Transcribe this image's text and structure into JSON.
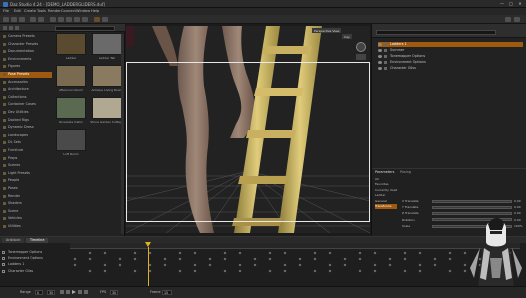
{
  "window": {
    "title": "Daz Studio 4.24 - [DEMO_LADDERGLIDERS.duf]",
    "controls": [
      "—",
      "□",
      "✕"
    ]
  },
  "menu": [
    "File",
    "Edit",
    "Create",
    "Tools",
    "Render",
    "Connect",
    "Window",
    "Help"
  ],
  "content_tree": {
    "items": [
      {
        "label": "Camera Presets",
        "selected": false
      },
      {
        "label": "Character Presets",
        "selected": false
      },
      {
        "label": "Documentation",
        "selected": false
      },
      {
        "label": "Environments",
        "selected": false
      },
      {
        "label": "Figures",
        "selected": false
      },
      {
        "label": "Pose Presets",
        "selected": true
      },
      {
        "label": "Accessories",
        "selected": false
      },
      {
        "label": "Architecture",
        "selected": false
      },
      {
        "label": "Collections",
        "selected": false
      },
      {
        "label": "Container Cases",
        "selected": false
      },
      {
        "label": "Dev Utilities",
        "selected": false
      },
      {
        "label": "Docked Rigs",
        "selected": false
      },
      {
        "label": "Dynamic Dress",
        "selected": false
      },
      {
        "label": "Landscapes",
        "selected": false
      },
      {
        "label": "DL Sets",
        "selected": false
      },
      {
        "label": "Furniture",
        "selected": false
      },
      {
        "label": "Props",
        "selected": false
      },
      {
        "label": "Scenes",
        "selected": false
      },
      {
        "label": "Light Presets",
        "selected": false
      },
      {
        "label": "People",
        "selected": false
      },
      {
        "label": "Poses",
        "selected": false
      },
      {
        "label": "Render",
        "selected": false
      },
      {
        "label": "Shaders",
        "selected": false
      },
      {
        "label": "Scene",
        "selected": false
      },
      {
        "label": "Vehicles",
        "selected": false
      },
      {
        "label": "Utilities",
        "selected": false
      }
    ]
  },
  "thumbnails": [
    {
      "label": "Ladder",
      "color": "#5a4a30"
    },
    {
      "label": "Ladder Tall",
      "color": "#6a6a6a"
    },
    {
      "label": "Afternoon Room",
      "color": "#7a6a50"
    },
    {
      "label": "Antique Living Room",
      "color": "#8a7a60"
    },
    {
      "label": "Riverside Cabin",
      "color": "#5a6a50"
    },
    {
      "label": "Stone Garden Cottage",
      "color": "#b0a890"
    },
    {
      "label": "Loft Room",
      "color": "#4a4a4a"
    }
  ],
  "viewport": {
    "camera_label": "Perspective View",
    "style_label": "Iray",
    "grid": true
  },
  "scene": {
    "items": [
      {
        "label": "Ladders 1",
        "selected": true
      },
      {
        "label": "Summer",
        "selected": false
      },
      {
        "label": "Tonemapper Options",
        "selected": false
      },
      {
        "label": "Environment Options",
        "selected": false
      },
      {
        "label": "Character Gliss",
        "selected": false
      }
    ]
  },
  "parameters": {
    "tabs": [
      "Parameters",
      "Posing"
    ],
    "groups": [
      "All",
      "Favorites",
      "Currently Used",
      "Ladder",
      "General",
      "Transforms"
    ],
    "rows": [
      {
        "label": "X Translate",
        "value": "0.00"
      },
      {
        "label": "Y Translate",
        "value": "0.00"
      },
      {
        "label": "Z Translate",
        "value": "0.00"
      },
      {
        "label": "Rotation",
        "value": "0.00"
      },
      {
        "label": "Scale",
        "value": "100%"
      }
    ]
  },
  "timeline": {
    "tabs": [
      "Aniblock",
      "Timeline"
    ],
    "rows": [
      "Tonemapper Options",
      "Environment Options",
      "Ladders 1",
      "Character Gliss"
    ]
  },
  "bottombar": {
    "range_label": "Range",
    "range_start": "0",
    "range_end": "30",
    "fps_label": "FPS",
    "fps": "30",
    "frame_label": "Frame",
    "frame": "15"
  },
  "colors": {
    "accent": "#a05a10",
    "ladder": "#c8b060",
    "frame_border": "#e8e8e8"
  }
}
